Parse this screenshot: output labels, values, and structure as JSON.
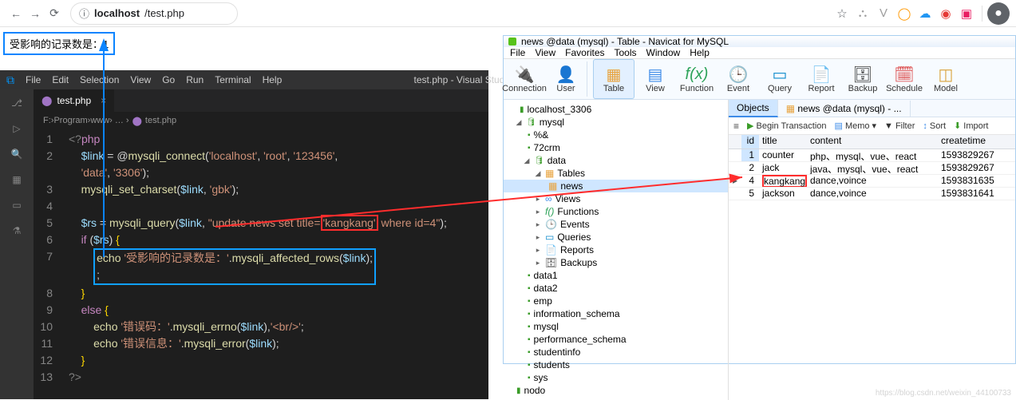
{
  "chrome": {
    "url_label": "localhost",
    "url_path": "/test.php"
  },
  "pageOutput": "受影响的记录数是：1",
  "vscode": {
    "menu": [
      "File",
      "Edit",
      "Selection",
      "View",
      "Go",
      "Run",
      "Terminal",
      "Help"
    ],
    "title": "test.php - Visual Studio Code [Administrator]",
    "tab": "test.php",
    "breadcrumb": {
      "a": "F:",
      "b": "Program",
      "c": "www",
      "d": "test.php"
    },
    "code": {
      "l1a": "<?",
      "l1b": "php",
      "l2_var": "$link",
      "l2_eq": " = @",
      "l2_fn": "mysqli_connect",
      "l2_p": "(",
      "l2_s1": "'localhost'",
      "l2_c1": ", ",
      "l2_s2": "'root'",
      "l2_c2": ", ",
      "l2_s3": "'123456'",
      "l2_c3": ", ",
      "l2_s4": "'data'",
      "l2_c4": ", ",
      "l2_s5": "'3306'",
      "l2_p2": ");",
      "l3_fn": "mysqli_set_charset",
      "l3_p": "(",
      "l3_v": "$link",
      "l3_c": ", ",
      "l3_s": "'gbk'",
      "l3_p2": ");",
      "l5_var": "$rs",
      "l5_eq": " = ",
      "l5_fn": "mysqli_query",
      "l5_p": "(",
      "l5_v": "$link",
      "l5_c": ", ",
      "l5_s1": "\"update news set title=",
      "l5_hl": "'kangkang'",
      "l5_s2": " where id=4\"",
      "l5_p2": ");",
      "l6_if": "if",
      "l6_p": " (",
      "l6_v": "$rs",
      "l6_p2": ") ",
      "l6_b": "{",
      "l7_echo": "echo ",
      "l7_s1": "'受影响的记录数是：'",
      "l7_d": ".",
      "l7_fn": "mysqli_affected_rows",
      "l7_p": "(",
      "l7_v": "$link",
      "l7_p2": ");",
      "l8_b": "}",
      "l9_else": "else",
      "l9_sp": " ",
      "l9_b": "{",
      "l10_echo": "echo ",
      "l10_s": "'错误码：'",
      "l10_d": ".",
      "l10_fn": "mysqli_errno",
      "l10_p": "(",
      "l10_v": "$link",
      "l10_p2": "),",
      "l10_s2": "'<br/>'",
      "l10_p3": ";",
      "l11_echo": "echo ",
      "l11_s": "'错误信息：'",
      "l11_d": ".",
      "l11_fn": "mysqli_error",
      "l11_p": "(",
      "l11_v": "$link",
      "l11_p2": ");",
      "l12_b": "}",
      "l13": "?>"
    }
  },
  "navicat": {
    "title": "news @data (mysql) - Table - Navicat for MySQL",
    "menu": [
      "File",
      "View",
      "Favorites",
      "Tools",
      "Window",
      "Help"
    ],
    "tools": [
      "Connection",
      "User",
      "Table",
      "View",
      "Function",
      "Event",
      "Query",
      "Report",
      "Backup",
      "Schedule",
      "Model"
    ],
    "tree": {
      "root": "localhost_3306",
      "mysqlDb": "mysql",
      "pct": "%&",
      "crm": "72crm",
      "data": "data",
      "tables": "Tables",
      "news": "news",
      "views": "Views",
      "functions": "Functions",
      "events": "Events",
      "queries": "Queries",
      "reports": "Reports",
      "backups": "Backups",
      "others": [
        "data1",
        "data2",
        "emp",
        "information_schema",
        "mysql",
        "performance_schema",
        "studentinfo",
        "students",
        "sys",
        "nodo"
      ]
    },
    "objTabs": {
      "objects": "Objects",
      "news": "news @data (mysql) - ..."
    },
    "gridTools": {
      "begin": "Begin Transaction",
      "memo": "Memo",
      "filter": "Filter",
      "sort": "Sort",
      "import": "Import"
    },
    "columns": [
      "id",
      "title",
      "content",
      "createtime"
    ],
    "rows": [
      {
        "id": "1",
        "title": "counter",
        "content": "php、mysql、vue、react",
        "ct": "1593829267"
      },
      {
        "id": "2",
        "title": "jack",
        "content": "java、mysql、vue、react",
        "ct": "1593829267"
      },
      {
        "id": "4",
        "title": "kangkang",
        "content": "dance,voince",
        "ct": "1593831635"
      },
      {
        "id": "5",
        "title": "jackson",
        "content": "dance,voince",
        "ct": "1593831641"
      }
    ]
  },
  "watermark": "https://blog.csdn.net/weixin_44100733"
}
